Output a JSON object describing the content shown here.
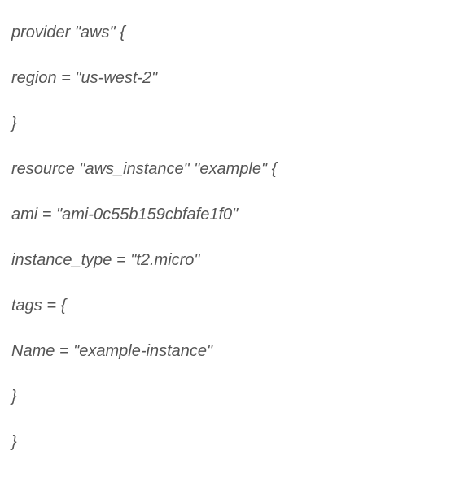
{
  "code": {
    "lines": [
      "provider \"aws\" {",
      "region = \"us-west-2\"",
      "}",
      "resource \"aws_instance\" \"example\" {",
      "ami = \"ami-0c55b159cbfafe1f0\"",
      "instance_type = \"t2.micro\"",
      "tags = {",
      "Name = \"example-instance\"",
      "}",
      "}"
    ]
  }
}
